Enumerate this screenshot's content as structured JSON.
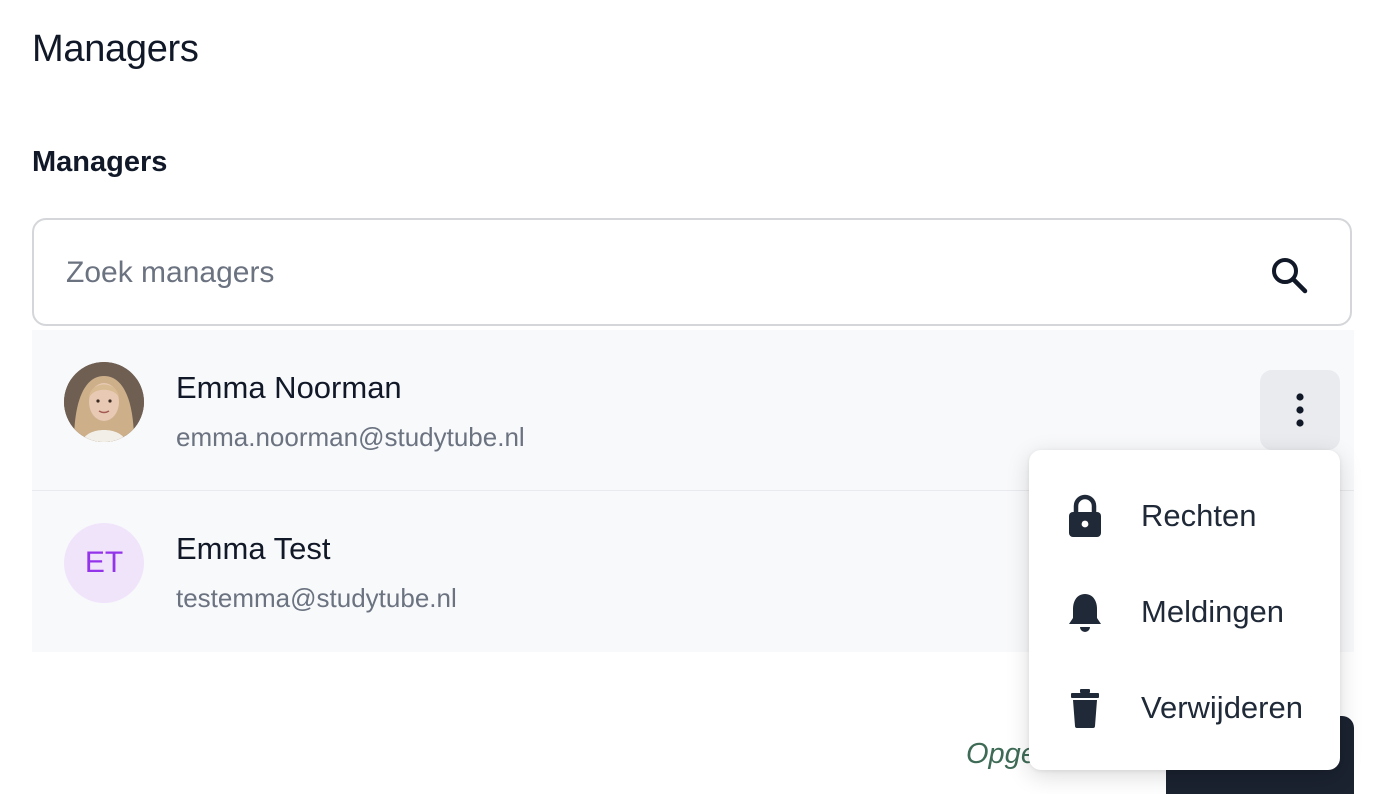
{
  "page": {
    "title": "Managers"
  },
  "section": {
    "title": "Managers"
  },
  "search": {
    "placeholder": "Zoek managers",
    "icon": "search-icon"
  },
  "managers": [
    {
      "name": "Emma Noorman",
      "email": "emma.noorman@studytube.nl",
      "avatar": "photo"
    },
    {
      "name": "Emma Test",
      "email": "testemma@studytube.nl",
      "avatar_initials": "ET"
    }
  ],
  "actions_menu": {
    "items": [
      {
        "label": "Rechten",
        "icon": "lock-icon"
      },
      {
        "label": "Meldingen",
        "icon": "bell-icon"
      },
      {
        "label": "Verwijderen",
        "icon": "trash-icon"
      }
    ]
  },
  "footer": {
    "status_text": "Opge",
    "save_label": ""
  },
  "colors": {
    "text_primary": "#111827",
    "text_secondary": "#6b7280",
    "initials_bg": "#f0e4fb",
    "initials_fg": "#9333ea",
    "status_green": "#3e6b56",
    "button_dark": "#1b2230"
  }
}
